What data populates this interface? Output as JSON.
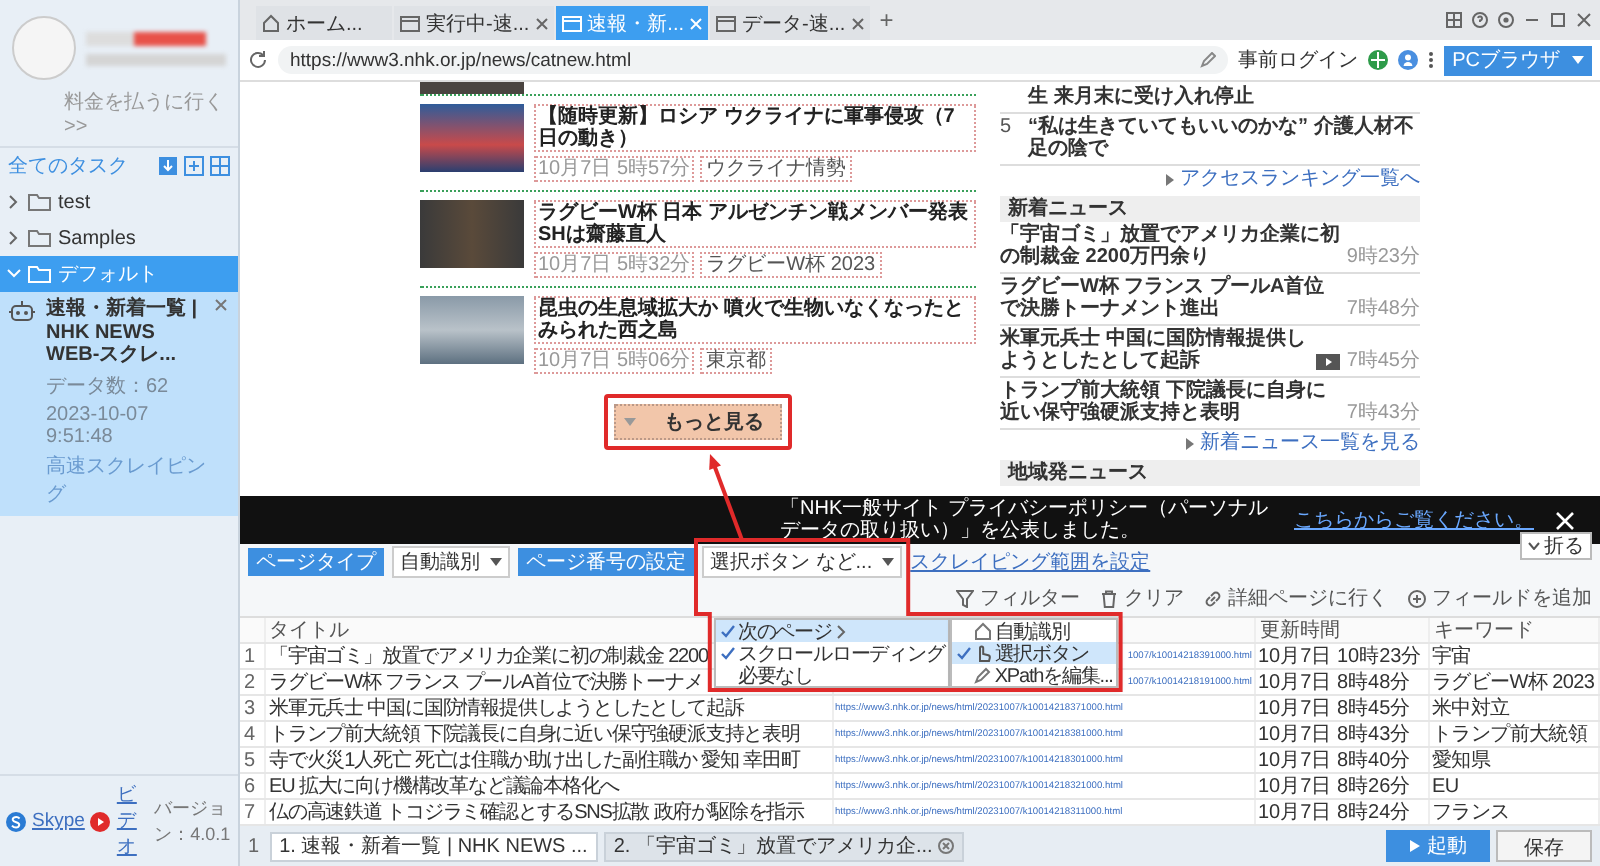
{
  "sidebar": {
    "billing_link": "料金を払うに行く >>",
    "all_tasks": "全てのタスク",
    "tree": [
      {
        "label": "test",
        "expanded": false,
        "selected": false
      },
      {
        "label": "Samples",
        "expanded": false,
        "selected": false
      },
      {
        "label": "デフォルト",
        "expanded": true,
        "selected": true,
        "children": [
          {
            "title": "速報・新着一覧 | NHK NEWS WEB-スクレ...",
            "data_count": "データ数：62",
            "date": "2023-10-07 9:51:48",
            "mode": "高速スクレイピング"
          }
        ]
      }
    ],
    "footer": {
      "skype": "Skype",
      "video": "ビデオ",
      "version": "バージョン：4.0.1"
    }
  },
  "browser_tabs": [
    {
      "kind": "home",
      "label": "ホーム...",
      "selected": false,
      "closable": false
    },
    {
      "kind": "page",
      "label": "実行中-速...",
      "selected": false,
      "closable": true
    },
    {
      "kind": "page",
      "label": "速報・新...",
      "selected": true,
      "closable": true
    },
    {
      "kind": "page",
      "label": "データ-速...",
      "selected": false,
      "closable": true
    }
  ],
  "new_tab": "+",
  "address_bar": {
    "url": "https://www3.nhk.or.jp/news/catnew.html",
    "pre_login": "事前ログイン",
    "mode_button": "PCブラウザ"
  },
  "page": {
    "articles": [
      {
        "title": "【随時更新】ロシア ウクライナに軍事侵攻（7日の動き）",
        "time": "10月7日 5時57分",
        "tag": "ウクライナ情勢"
      },
      {
        "title": "ラグビーW杯 日本 アルゼンチン戦メンバー発表 SHは齋藤直人",
        "time": "10月7日 5時32分",
        "tag": "ラグビーW杯 2023"
      },
      {
        "title": "昆虫の生息域拡大か 噴火で生物いなくなったとみられた西之島",
        "time": "10月7日 5時06分",
        "tag": "東京都"
      }
    ],
    "more_button": "もっと見る",
    "ranking": [
      {
        "title": "生 来月末に受け入れ停止"
      },
      {
        "rank": "5",
        "title": "“私は生きていてもいいのかな” 介護人材不足の陰で"
      }
    ],
    "ranking_link": "アクセスランキング一覧へ",
    "new_heading": "新着ニュース",
    "new_items": [
      {
        "title": "「宇宙ゴミ」放置でアメリカ企業に初の制裁金 2200万円余り",
        "time": "9時23分",
        "video": false
      },
      {
        "title": "ラグビーW杯 フランス プールA首位で決勝トーナメント進出",
        "time": "7時48分",
        "video": false
      },
      {
        "title": "米軍元兵士 中国に国防情報提供しようとしたとして起訴",
        "time": "7時45分",
        "video": true
      },
      {
        "title": "トランプ前大統領 下院議長に自身に近い保守強硬派支持と表明",
        "time": "7時43分",
        "video": false
      }
    ],
    "new_link": "新着ニュース一覧を見る",
    "local_heading": "地域発ニュース"
  },
  "banner": {
    "text": "「NHK一般サイト プライバシーポリシー（パーソナルデータの取り扱い）」を公表しました。",
    "link": "こちらからご覧ください。"
  },
  "fold_button": "折る",
  "toolbar": {
    "page_type_label": "ページタイプ",
    "page_type_value": "自動識別",
    "paging_label": "ページ番号の設定",
    "paging_value": "選択ボタン など...",
    "range_link": "スクレイピング範囲を設定",
    "actions": [
      {
        "kind": "filter",
        "label": "フィルター"
      },
      {
        "kind": "clear",
        "label": "クリア"
      },
      {
        "kind": "detail",
        "label": "詳細ページに行く"
      },
      {
        "kind": "add",
        "label": "フィールドを追加"
      }
    ]
  },
  "paging_menu": [
    {
      "label": "次のページ",
      "checked": true,
      "selected": true,
      "submenu": true
    },
    {
      "label": "スクロールローディング",
      "checked": true,
      "selected": false,
      "submenu": false
    },
    {
      "label": "必要なし",
      "checked": false,
      "selected": false,
      "submenu": false
    }
  ],
  "paging_submenu": [
    {
      "kind": "auto",
      "label": "自動識別",
      "checked": false,
      "selected": false
    },
    {
      "kind": "button",
      "label": "選択ボタン",
      "checked": true,
      "selected": true
    },
    {
      "kind": "xpath",
      "label": "XPathを編集...",
      "checked": false,
      "selected": false
    }
  ],
  "table": {
    "columns": {
      "title": "タイトル",
      "updated": "更新時間",
      "keyword": "キーワード"
    },
    "rows": [
      {
        "number": "1",
        "title": "「宇宙ゴミ」放置でアメリカ企業に初の制裁金 2200",
        "url": "1007/k10014218391000.html",
        "covered": true,
        "updated": "10月7日 10時23分",
        "keyword": "宇宙"
      },
      {
        "number": "2",
        "title": "ラグビーW杯 フランス プールA首位で決勝トーナメ",
        "url": "1007/k10014218191000.html",
        "covered": true,
        "updated": "10月7日 8時48分",
        "keyword": "ラグビーW杯 2023"
      },
      {
        "number": "3",
        "title": "米軍元兵士 中国に国防情報提供しようとしたとして起訴",
        "url": "https://www3.nhk.or.jp/news/html/20231007/k10014218371000.html",
        "covered": false,
        "updated": "10月7日 8時45分",
        "keyword": "米中対立"
      },
      {
        "number": "4",
        "title": "トランプ前大統領 下院議長に自身に近い保守強硬派支持と表明",
        "url": "https://www3.nhk.or.jp/news/html/20231007/k10014218381000.html",
        "covered": false,
        "updated": "10月7日 8時43分",
        "keyword": "トランプ前大統領"
      },
      {
        "number": "5",
        "title": "寺で火災1人死亡 死亡は住職か助け出した副住職か 愛知 幸田町",
        "url": "https://www3.nhk.or.jp/news/html/20231007/k10014218301000.html",
        "covered": false,
        "updated": "10月7日 8時40分",
        "keyword": "愛知県"
      },
      {
        "number": "6",
        "title": "EU 拡大に向け機構改革など議論本格化へ",
        "url": "https://www3.nhk.or.jp/news/html/20231007/k10014218321000.html",
        "covered": false,
        "updated": "10月7日 8時26分",
        "keyword": "EU"
      },
      {
        "number": "7",
        "title": "仏の高速鉄道 トコジラミ確認とするSNS拡散 政府が駆除を指示",
        "url": "https://www3.nhk.or.jp/news/html/20231007/k10014218311000.html",
        "covered": false,
        "updated": "10月7日 8時24分",
        "keyword": "フランス"
      }
    ]
  },
  "pager": "1",
  "bottom_tabs": [
    {
      "label": "1. 速報・新着一覧 | NHK NEWS ...",
      "selected": true,
      "closable": false
    },
    {
      "label": "2. 「宇宙ゴミ」放置でアメリカ企...",
      "selected": false,
      "closable": true
    }
  ],
  "buttons": {
    "start": "起動",
    "save": "保存"
  }
}
